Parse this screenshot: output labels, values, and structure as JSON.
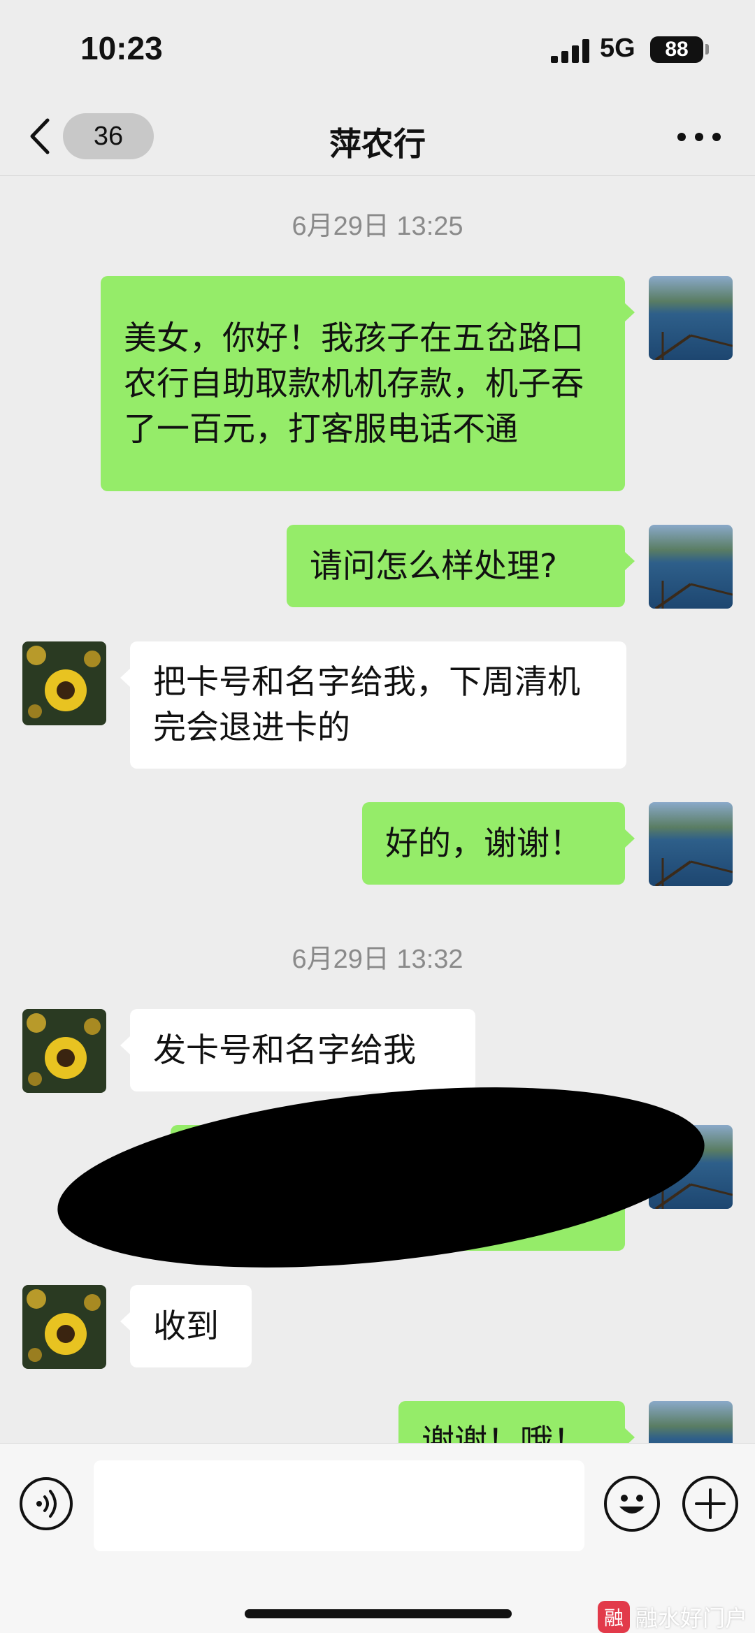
{
  "status": {
    "time": "10:23",
    "network": "5G",
    "battery": "88"
  },
  "nav": {
    "unread_count": "36",
    "title": "萍农行"
  },
  "messages": [
    {
      "kind": "timestamp",
      "text": "6月29日 13:25"
    },
    {
      "kind": "sent",
      "text": "美女，你好！我孩子在五岔路口农行自助取款机机存款，机子吞了一百元，打客服电话不通"
    },
    {
      "kind": "sent",
      "text": "请问怎么样处理?"
    },
    {
      "kind": "received",
      "text": "把卡号和名字给我，下周清机完会退进卡的"
    },
    {
      "kind": "sent",
      "text": "好的，谢谢！"
    },
    {
      "kind": "timestamp",
      "text": "6月29日 13:32"
    },
    {
      "kind": "received",
      "text": "发卡号和名字给我"
    },
    {
      "kind": "sent",
      "text": "",
      "redacted": true
    },
    {
      "kind": "received",
      "text": "收到"
    },
    {
      "kind": "sent",
      "text": "谢谢！哦！",
      "partially_visible": true
    }
  ],
  "input": {
    "value": ""
  },
  "watermark": {
    "logo_text": "融",
    "text": "融水好门户"
  },
  "colors": {
    "sent_bubble": "#95ec69",
    "received_bubble": "#ffffff",
    "background": "#ededed"
  },
  "icons": [
    "chevron-left-icon",
    "more-icon",
    "voice-icon",
    "emoji-icon",
    "plus-icon",
    "signal-icon",
    "battery-icon"
  ]
}
